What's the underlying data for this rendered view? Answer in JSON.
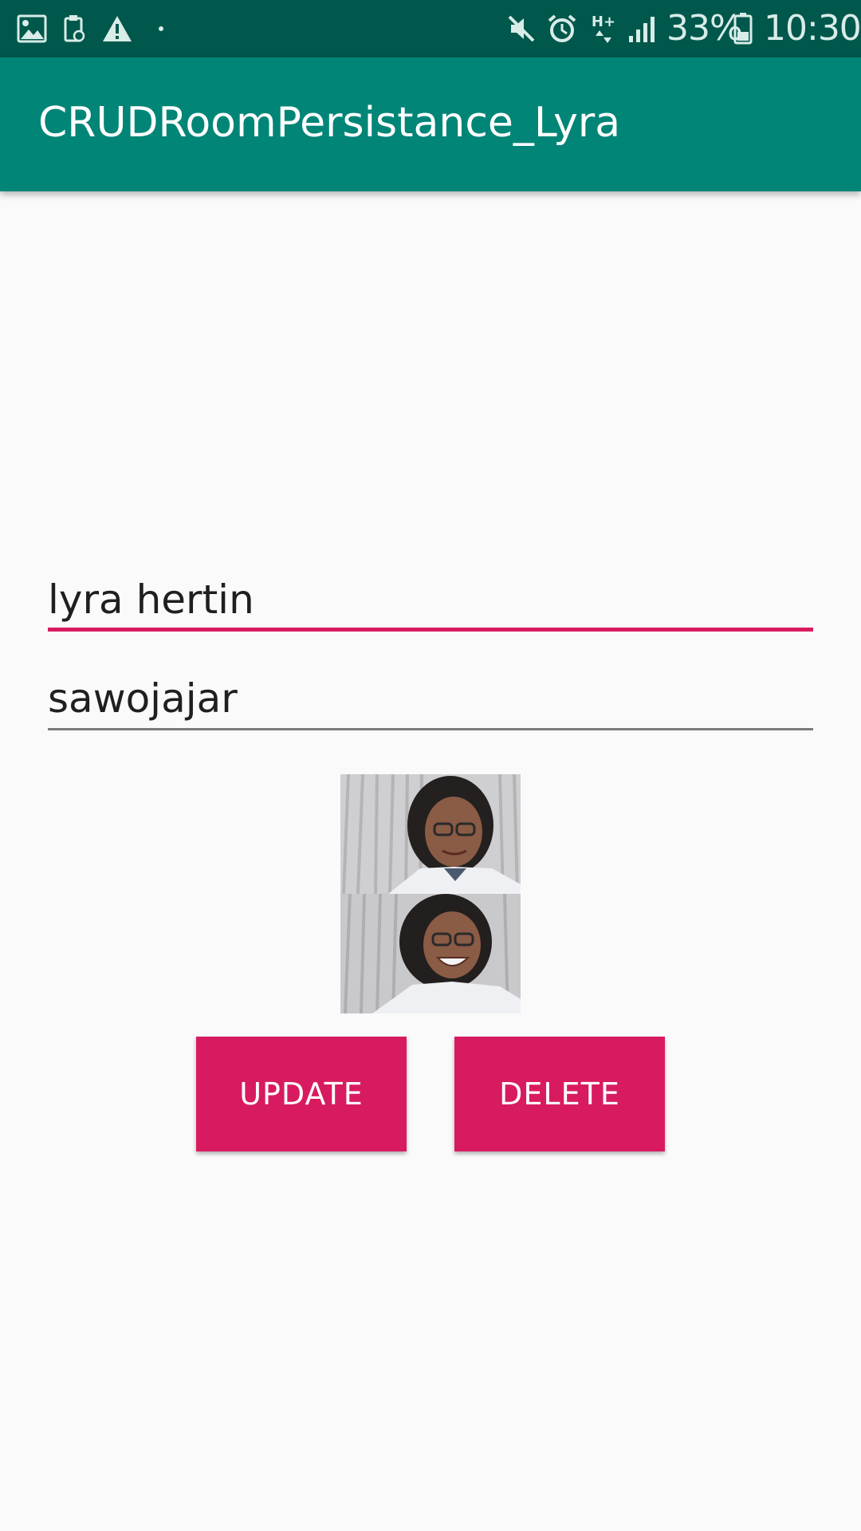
{
  "status_bar": {
    "battery": "33%",
    "time": "10:30",
    "icons": [
      "gallery-icon",
      "clipboard-icon",
      "warning-icon",
      "dot-icon",
      "mute-icon",
      "alarm-icon",
      "network-hplus-icon",
      "signal-icon",
      "battery-icon"
    ],
    "network_label": "H+"
  },
  "app_bar": {
    "title": "CRUDRoomPersistance_Lyra"
  },
  "form": {
    "name_value": "lyra hertin",
    "address_value": "sawojajar"
  },
  "buttons": {
    "update_label": "UPDATE",
    "delete_label": "DELETE"
  },
  "colors": {
    "status_bar": "#00574b",
    "primary": "#008577",
    "accent": "#d81b60",
    "background": "#fafafa"
  }
}
